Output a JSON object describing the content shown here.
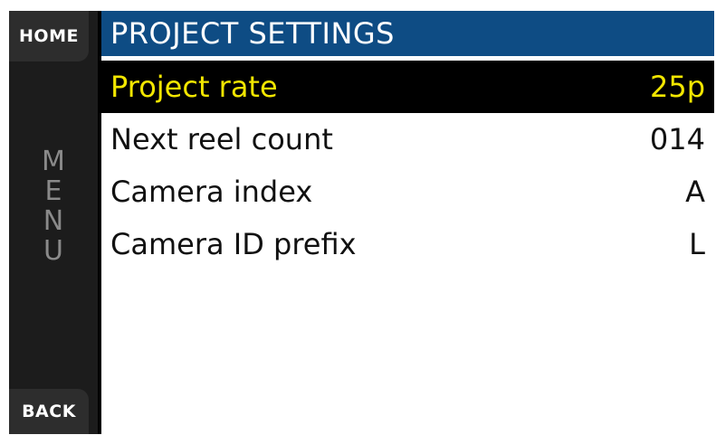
{
  "nav": {
    "home_label": "HOME",
    "back_label": "BACK",
    "menu_letters": [
      "M",
      "E",
      "N",
      "U"
    ]
  },
  "header": {
    "title": "PROJECT SETTINGS"
  },
  "settings": [
    {
      "label": "Project rate",
      "value": "25p",
      "selected": true
    },
    {
      "label": "Next reel count",
      "value": "014",
      "selected": false
    },
    {
      "label": "Camera index",
      "value": "A",
      "selected": false
    },
    {
      "label": "Camera ID prefix",
      "value": "L",
      "selected": false
    }
  ],
  "colors": {
    "title_bar": "#0e4c84",
    "selected_text": "#f2e600",
    "selected_bg": "#000000"
  }
}
